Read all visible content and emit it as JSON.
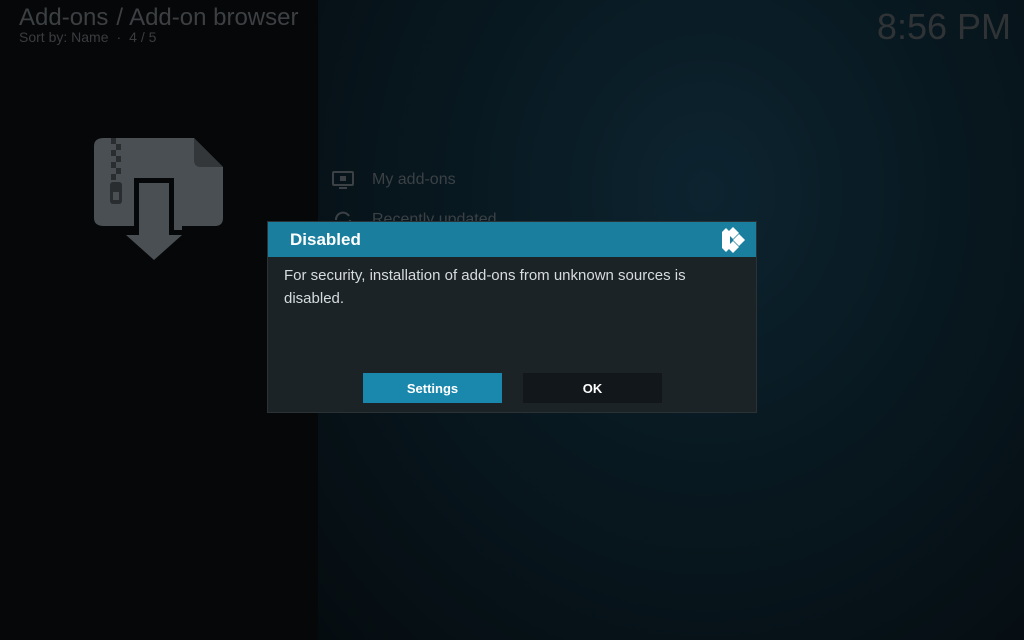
{
  "header": {
    "section": "Add-ons",
    "separator": "/",
    "page": "Add-on browser",
    "sort_label": "Sort by: Name",
    "dot": "·",
    "position": "4 / 5"
  },
  "clock": "8:56 PM",
  "menu": {
    "items": [
      {
        "label": "My add-ons",
        "icon": "monitor-icon"
      },
      {
        "label": "Recently updated",
        "icon": "refresh-icon"
      }
    ]
  },
  "dialog": {
    "title": "Disabled",
    "message": "For security, installation of add-ons from unknown sources is disabled.",
    "buttons": {
      "settings": "Settings",
      "ok": "OK"
    }
  },
  "colors": {
    "accent": "#1a7f9e",
    "button_focus": "#1a88ad",
    "dialog_bg": "#1c2327"
  }
}
